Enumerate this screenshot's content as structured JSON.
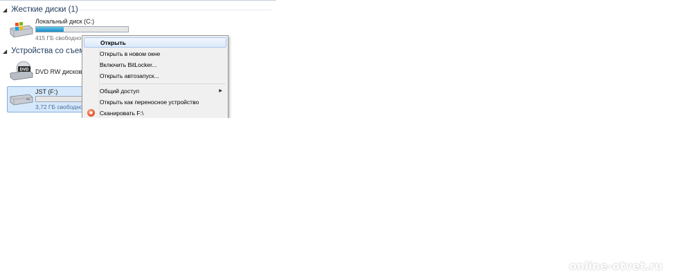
{
  "groups": {
    "hard_disks": {
      "title": "Жесткие диски (1)"
    },
    "removable": {
      "title": "Устройства со съемн"
    }
  },
  "drives": {
    "local_c": {
      "name": "Локальный диск (C:)",
      "free": "415 ГБ свободно",
      "free_tail": "...",
      "fill_fraction": 0.3
    },
    "dvd": {
      "name": "DVD RW дисковод",
      "icon_label": "DVD"
    },
    "jst_f": {
      "name": "JST (F:)",
      "free": "3,72 ГБ свободно",
      "fill_fraction": 0.0
    }
  },
  "context_menu": {
    "items": [
      {
        "label": "Открыть",
        "bold": true,
        "hover": true
      },
      {
        "label": "Открыть в новом окне"
      },
      {
        "label": "Включить BitLocker..."
      },
      {
        "label": "Открыть автозапуск..."
      },
      {
        "label": "Общий доступ",
        "submenu": true
      },
      {
        "label": "Открыть как переносное устройство"
      },
      {
        "label": "Сканировать F:\\",
        "icon": "antivirus-scan-icon"
      }
    ]
  },
  "watermark": "online-otvet.ru"
}
